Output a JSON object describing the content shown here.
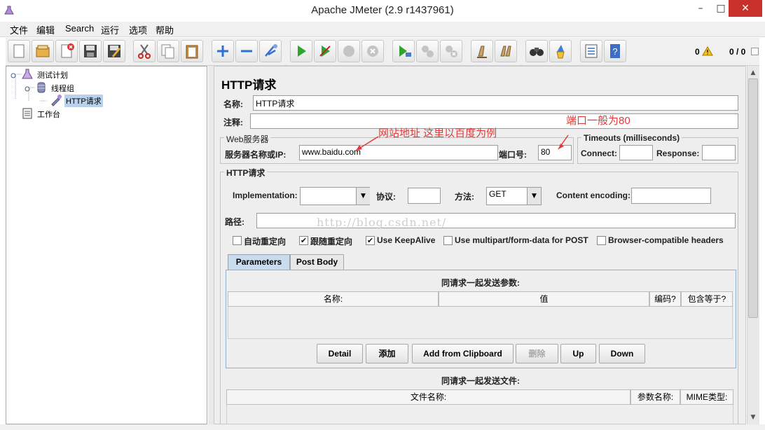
{
  "window": {
    "title": "Apache JMeter (2.9 r1437961)",
    "controls": {
      "minimize": "–",
      "maximize": "□",
      "close": "✕"
    }
  },
  "menu": [
    "文件",
    "编辑",
    "Search",
    "运行",
    "选项",
    "帮助"
  ],
  "toolbar": {
    "buttons": [
      "new-icon",
      "open-icon",
      "close-file-icon",
      "save-icon",
      "save-as-icon",
      "cut-icon",
      "copy-icon",
      "paste-icon",
      "expand-icon",
      "collapse-icon",
      "toggle-icon",
      "start-icon",
      "start-no-timers-icon",
      "stop-icon",
      "shutdown-icon",
      "remote-start-icon",
      "remote-stop-icon",
      "remote-shutdown-icon",
      "clear-icon",
      "clear-all-icon",
      "search-icon",
      "reset-search-icon",
      "function-helper-icon",
      "help-icon"
    ],
    "warning_count": "0",
    "thread_counter": "0 / 0"
  },
  "tree": {
    "test_plan": "测试计划",
    "thread_group": "线程组",
    "http_request": "HTTP请求",
    "workbench": "工作台"
  },
  "form": {
    "heading": "HTTP请求",
    "name_label": "名称:",
    "name_value": "HTTP请求",
    "comment_label": "注释:",
    "comment_value": "",
    "web_server_group": "Web服务器",
    "server_label": "服务器名称或IP:",
    "server_value": "www.baidu.com",
    "port_label": "端口号:",
    "port_value": "80",
    "timeouts_group": "Timeouts (milliseconds)",
    "connect_label": "Connect:",
    "connect_value": "",
    "response_label": "Response:",
    "response_value": "",
    "http_group": "HTTP请求",
    "implementation_label": "Implementation:",
    "implementation_value": "",
    "protocol_label": "协议:",
    "protocol_value": "",
    "method_label": "方法:",
    "method_value": "GET",
    "encoding_label": "Content encoding:",
    "encoding_value": "",
    "path_label": "路径:",
    "path_value": ""
  },
  "checkboxes": [
    {
      "label": "自动重定向",
      "checked": false
    },
    {
      "label": "跟随重定向",
      "checked": true
    },
    {
      "label": "Use KeepAlive",
      "checked": true
    },
    {
      "label": "Use multipart/form-data for POST",
      "checked": false
    },
    {
      "label": "Browser-compatible headers",
      "checked": false
    }
  ],
  "check_mark": "✔",
  "tabs": [
    "Parameters",
    "Post Body"
  ],
  "params": {
    "caption": "同请求一起发送参数:",
    "columns": [
      "名称:",
      "值",
      "编码?",
      "包含等于?"
    ],
    "buttons": [
      "Detail",
      "添加",
      "Add from Clipboard",
      "删除",
      "Up",
      "Down"
    ]
  },
  "files": {
    "caption": "同请求一起发送文件:",
    "columns": [
      "文件名称:",
      "参数名称:",
      "MIME类型:"
    ]
  },
  "annotations": {
    "server_note": "网站地址 这里以百度为例",
    "port_note": "端口一般为80"
  },
  "watermark": "http://blog.csdn.net/",
  "colors": {
    "annotation": "#e23a3a",
    "selection": "#b9d1ea",
    "close_button": "#c7302b"
  }
}
